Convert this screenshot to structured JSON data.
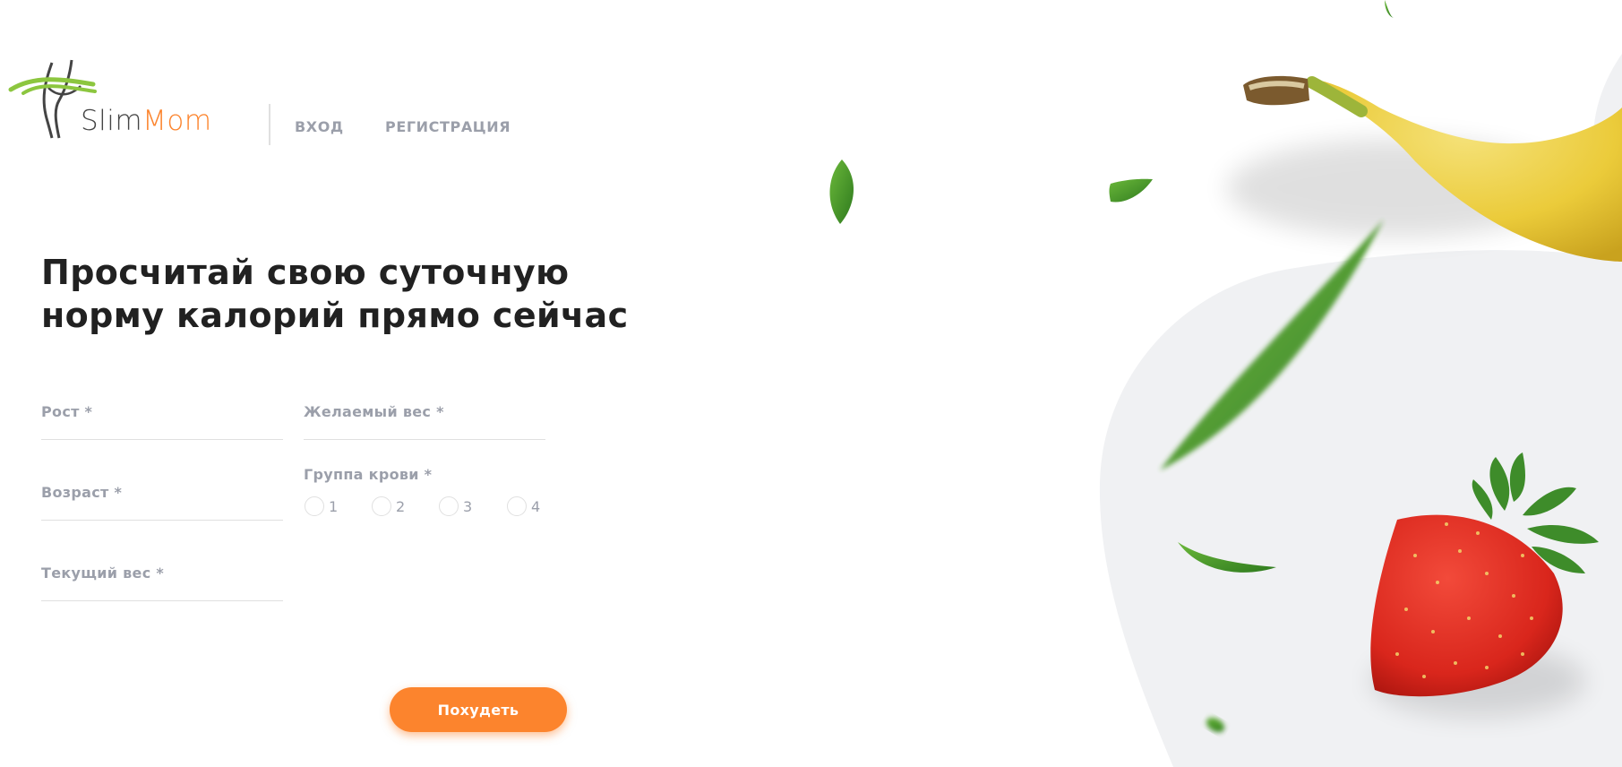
{
  "header": {
    "logo": {
      "part1": "Slim",
      "part2": "Mom"
    },
    "nav": {
      "login": "ВХОД",
      "register": "РЕГИСТРАЦИЯ"
    }
  },
  "main": {
    "title": "Просчитай свою суточную норму калорий прямо сейчас",
    "form": {
      "height_label": "Рост *",
      "desired_weight_label": "Желаемый вес *",
      "age_label": "Возраст *",
      "blood_group_label": "Группа крови *",
      "current_weight_label": "Текущий вес *",
      "blood_options": [
        "1",
        "2",
        "3",
        "4"
      ],
      "submit_label": "Похудеть"
    }
  },
  "colors": {
    "accent": "#FC842D",
    "text_dark": "#212121",
    "text_muted": "#9B9FAA",
    "line": "#E0E0E0",
    "blob": "#F0F1F3"
  },
  "decoration": {
    "images": [
      "banana-image",
      "strawberry-image",
      "leaf-image"
    ]
  }
}
